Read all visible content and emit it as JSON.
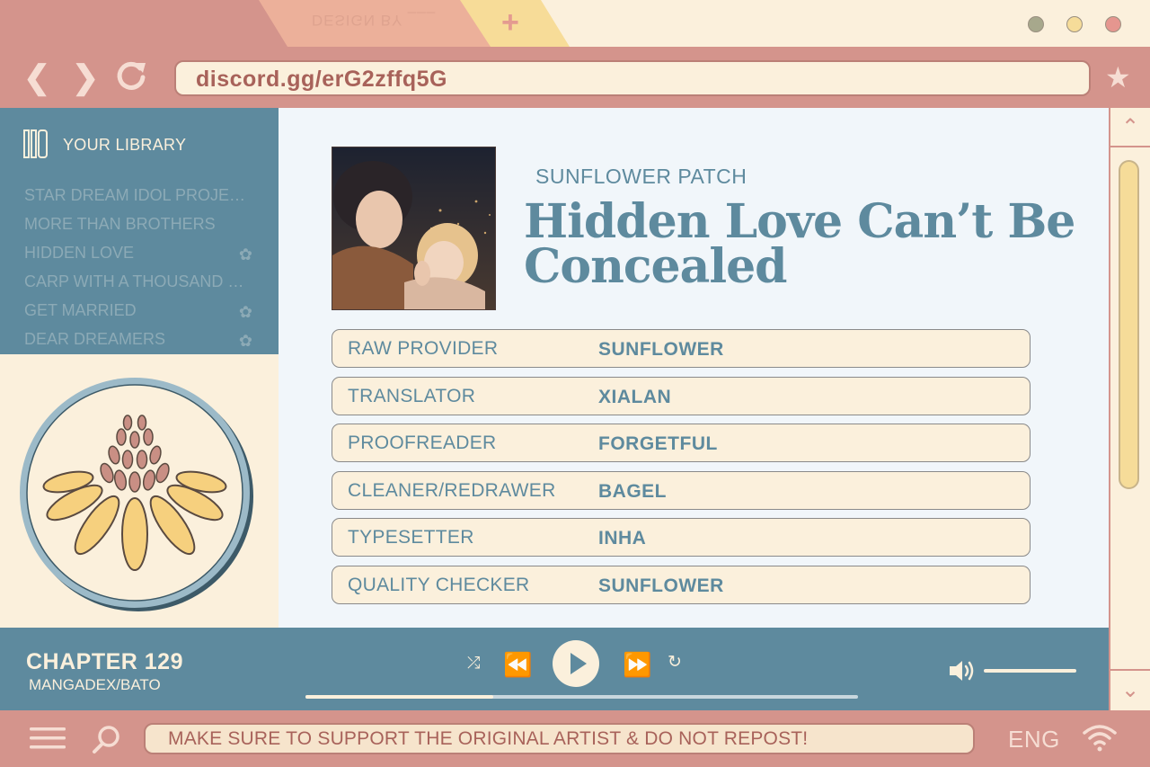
{
  "tabs": {
    "active_label": "DESIGN BY ___",
    "new_tab_label": "+"
  },
  "window_controls": [
    "minimize",
    "maximize",
    "close"
  ],
  "address_bar": {
    "url": "discord.gg/erG2zffq5G"
  },
  "library": {
    "title": "YOUR LIBRARY",
    "items": [
      {
        "label": "STAR DREAM IDOL PROJECT",
        "flower": false
      },
      {
        "label": "MORE THAN BROTHERS",
        "flower": false
      },
      {
        "label": "HIDDEN LOVE",
        "flower": true
      },
      {
        "label": "CARP WITH A THOUSAND E...",
        "flower": false
      },
      {
        "label": "GET MARRIED",
        "flower": true
      },
      {
        "label": "DEAR DREAMERS",
        "flower": true
      }
    ]
  },
  "header": {
    "group": "SUNFLOWER PATCH",
    "title": "Hidden Love Can’t Be Concealed"
  },
  "credits": [
    {
      "role": "RAW PROVIDER",
      "name": "SUNFLOWER"
    },
    {
      "role": "TRANSLATOR",
      "name": "XIALAN"
    },
    {
      "role": "PROOFREADER",
      "name": "FORGETFUL"
    },
    {
      "role": "CLEANER/REDRAWER",
      "name": "BAGEL"
    },
    {
      "role": "TYPESETTER",
      "name": "INHA"
    },
    {
      "role": "QUALITY CHECKER",
      "name": "SUNFLOWER"
    }
  ],
  "player": {
    "chapter": "CHAPTER 129",
    "source": "MANGADEX/BATO",
    "progress": 0.34,
    "volume": 1.0
  },
  "bottom_bar": {
    "notice": "MAKE SURE TO SUPPORT THE ORIGINAL ARTIST & DO NOT REPOST!",
    "language": "ENG"
  },
  "colors": {
    "rose": "#d4948c",
    "cream": "#fbf0dc",
    "teal": "#5e8a9e",
    "yellow": "#f6dc99"
  }
}
